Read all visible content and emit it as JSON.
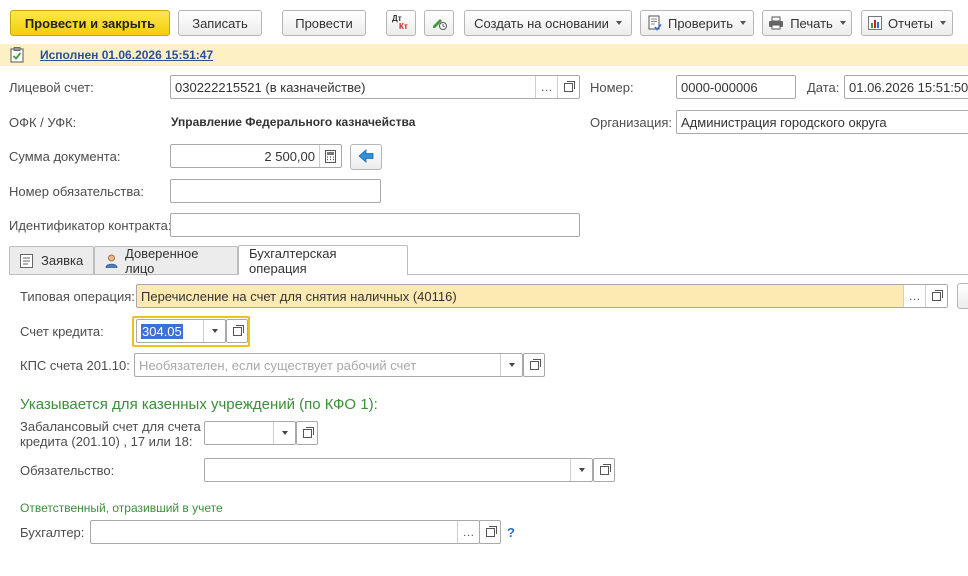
{
  "toolbar": {
    "post_close_label": "Провести и закрыть",
    "save_label": "Записать",
    "post_label": "Провести",
    "dtkt_icon": "dt-kt-icon",
    "dt_label": "Дт",
    "kt_label": "Кт",
    "edit_icon": "pencil-clock-icon",
    "create_based_label": "Создать на основании",
    "check_label": "Проверить",
    "print_label": "Печать",
    "reports_label": "Отчеты"
  },
  "status": {
    "text": "Исполнен 01.06.2026 15:51:47",
    "icon": "clipboard-check-icon"
  },
  "header": {
    "account_label": "Лицевой счет:",
    "account_value": "030222215521 (в казначействе)",
    "number_label": "Номер:",
    "number_value": "0000-000006",
    "date_label": "Дата:",
    "date_value": "01.06.2026 15:51:50",
    "ofk_label": "ОФК / УФК:",
    "ofk_value": "Управление Федерального казначейства",
    "org_label": "Организация:",
    "org_value": "Администрация городского округа",
    "sum_label": "Сумма документа:",
    "sum_value": "2 500,00",
    "obligation_number_label": "Номер обязательства:",
    "obligation_number_value": "",
    "contract_id_label": "Идентификатор контракта:",
    "contract_id_value": ""
  },
  "tabs": [
    {
      "label": "Заявка",
      "icon": "document-icon",
      "active": false
    },
    {
      "label": "Доверенное лицо",
      "icon": "person-icon",
      "active": false
    },
    {
      "label": "Бухгалтерская операция",
      "icon": "",
      "active": true
    }
  ],
  "operation": {
    "typical_label": "Типовая операция:",
    "typical_value": "Перечисление на счет для снятия наличных (40116)",
    "credit_account_label": "Счет кредита:",
    "credit_account_value": "304.05",
    "kps_label": "КПС счета 201.10:",
    "kps_placeholder": "Необязателен, если существует рабочий счет",
    "section_heading": "Указывается для казенных учреждений (по КФО 1):",
    "offbalance_label_line1": "Забалансовый счет для счета",
    "offbalance_label_line2": "кредита (201.10) , 17 или 18:",
    "offbalance_value": "",
    "obligation_label": "Обязательство:",
    "obligation_value": "",
    "responsible_heading": "Ответственный, отразивший в учете",
    "accountant_label": "Бухгалтер:",
    "accountant_value": "",
    "help_label": "?"
  },
  "colors": {
    "primary_button": "#f4cd0d",
    "status_bar": "#fdf0c4",
    "typical_field": "#fdeab3",
    "focus_border": "#f0c020",
    "selection": "#3d6fd6",
    "section_green": "#3a8f3a",
    "link_blue": "#2a4f9e"
  }
}
